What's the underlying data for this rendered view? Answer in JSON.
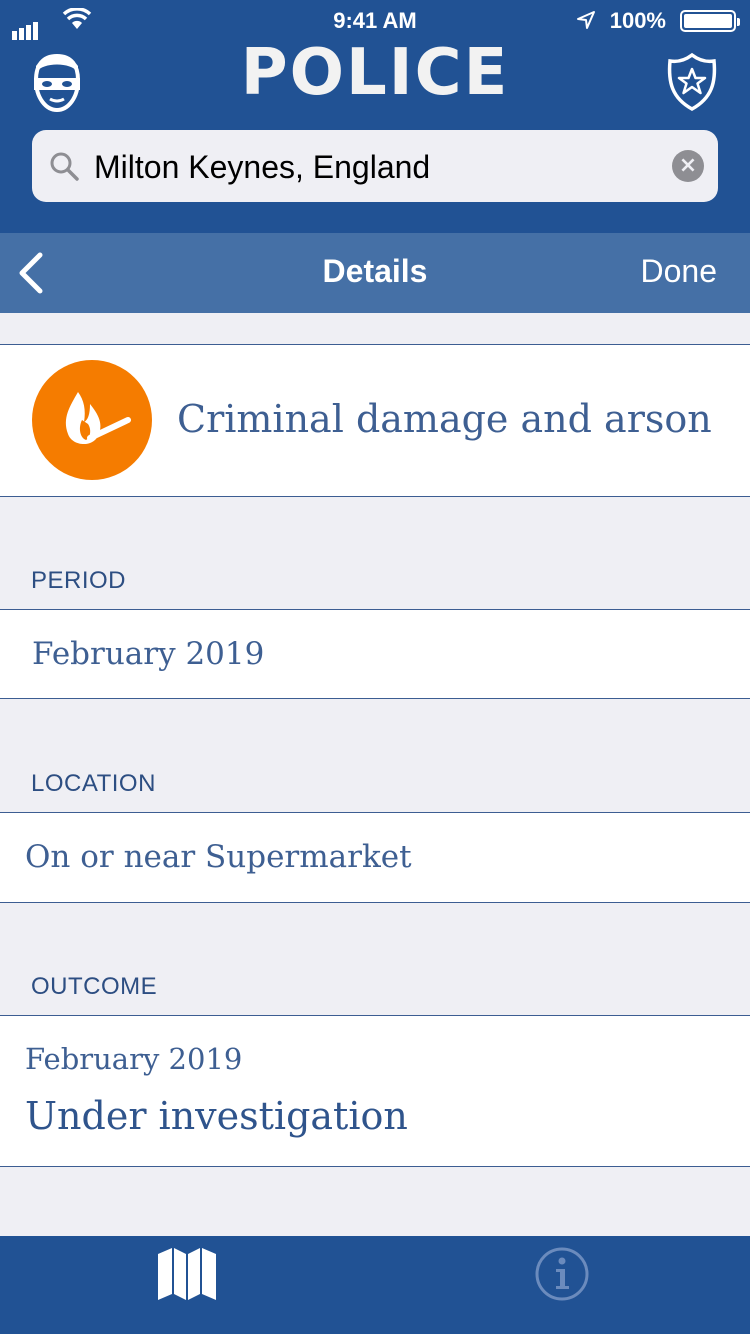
{
  "status_bar": {
    "time": "9:41 AM",
    "battery": "100%",
    "icons": [
      "signal-icon",
      "wifi-icon",
      "location-arrow-icon",
      "battery-icon"
    ]
  },
  "header": {
    "brand": "POLICE",
    "left_icon": "robber-icon",
    "right_icon": "police-badge-icon"
  },
  "search": {
    "value": "Milton Keynes, England",
    "icon": "search-icon",
    "clear_icon": "clear-icon"
  },
  "navbar": {
    "title": "Details",
    "done_label": "Done",
    "back_icon": "chevron-left-icon"
  },
  "crime": {
    "title": "Criminal damage and arson",
    "icon": "burning-match-icon",
    "icon_color": "#f57c00"
  },
  "sections": {
    "period": {
      "label": "PERIOD",
      "value": "February 2019"
    },
    "location": {
      "label": "LOCATION",
      "value": "On or near Supermarket"
    },
    "outcome": {
      "label": "OUTCOME",
      "date": "February 2019",
      "status": "Under investigation"
    }
  },
  "tabbar": {
    "tabs": [
      {
        "icon": "map-icon",
        "active": true
      },
      {
        "icon": "info-icon",
        "active": false
      }
    ]
  },
  "colors": {
    "brand_blue": "#215294",
    "nav_blue": "#4570a6",
    "text_blue": "#3e5f92",
    "background": "#efeff4"
  }
}
